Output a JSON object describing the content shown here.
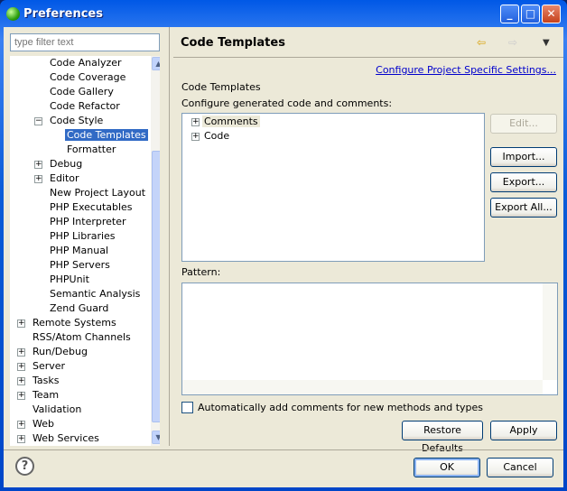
{
  "window": {
    "title": "Preferences",
    "minimize": "_",
    "maximize": "□",
    "close": "✕"
  },
  "sidebar": {
    "filter_placeholder": "type filter text",
    "items": [
      {
        "label": "Code Analyzer",
        "level": 2
      },
      {
        "label": "Code Coverage",
        "level": 2
      },
      {
        "label": "Code Gallery",
        "level": 2
      },
      {
        "label": "Code Refactor",
        "level": 2
      },
      {
        "label": "Code Style",
        "level": 2,
        "expander": "−"
      },
      {
        "label": "Code Templates",
        "level": 3,
        "selected": true
      },
      {
        "label": "Formatter",
        "level": 3
      },
      {
        "label": "Debug",
        "level": 2,
        "expander": "+"
      },
      {
        "label": "Editor",
        "level": 2,
        "expander": "+"
      },
      {
        "label": "New Project Layout",
        "level": 2
      },
      {
        "label": "PHP Executables",
        "level": 2
      },
      {
        "label": "PHP Interpreter",
        "level": 2
      },
      {
        "label": "PHP Libraries",
        "level": 2
      },
      {
        "label": "PHP Manual",
        "level": 2
      },
      {
        "label": "PHP Servers",
        "level": 2
      },
      {
        "label": "PHPUnit",
        "level": 2
      },
      {
        "label": "Semantic Analysis",
        "level": 2
      },
      {
        "label": "Zend Guard",
        "level": 2
      },
      {
        "label": "Remote Systems",
        "level": 1,
        "expander": "+"
      },
      {
        "label": "RSS/Atom Channels",
        "level": 1
      },
      {
        "label": "Run/Debug",
        "level": 1,
        "expander": "+"
      },
      {
        "label": "Server",
        "level": 1,
        "expander": "+"
      },
      {
        "label": "Tasks",
        "level": 1,
        "expander": "+"
      },
      {
        "label": "Team",
        "level": 1,
        "expander": "+"
      },
      {
        "label": "Validation",
        "level": 1
      },
      {
        "label": "Web",
        "level": 1,
        "expander": "+"
      },
      {
        "label": "Web Services",
        "level": 1,
        "expander": "+"
      }
    ]
  },
  "main": {
    "title": "Code Templates",
    "back_icon": "⇦",
    "forward_icon": "⇨",
    "menu_icon": "▼",
    "project_link": "Configure Project Specific Settings...",
    "section_label": "Code Templates",
    "configure_label": "Configure generated code and comments:",
    "templates": [
      {
        "label": "Comments",
        "expander": "+"
      },
      {
        "label": "Code",
        "expander": "+"
      }
    ],
    "buttons": {
      "edit": "Edit...",
      "import": "Import...",
      "export": "Export...",
      "export_all": "Export All..."
    },
    "pattern_label": "Pattern:",
    "auto_comments_label": "Automatically add comments for new methods and types",
    "auto_comments_checked": false,
    "restore_defaults": "Restore Defaults",
    "apply": "Apply"
  },
  "footer": {
    "help": "?",
    "ok": "OK",
    "cancel": "Cancel"
  }
}
